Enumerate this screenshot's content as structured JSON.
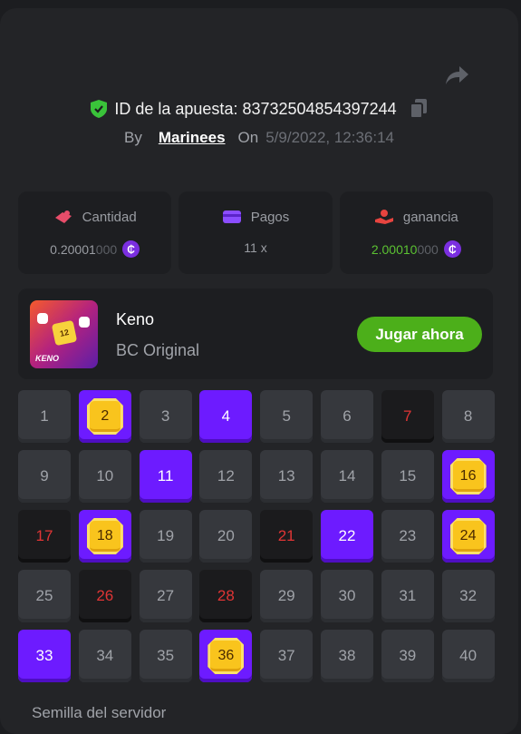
{
  "header": {
    "bet_id_label": "ID de la apuesta: 83732504854397244",
    "by_label": "By",
    "user": "Marinees",
    "on_label": "On",
    "date": "5/9/2022, 12:36:14"
  },
  "stats": [
    {
      "icon": "amount-icon",
      "label": "Cantidad",
      "value_main": "0.20001",
      "value_dim": "000",
      "color": "#e84d6a"
    },
    {
      "icon": "card-icon",
      "label": "Pagos",
      "value_main": "11 x",
      "value_dim": "",
      "color": "#8b4dff"
    },
    {
      "icon": "profit-icon",
      "label": "ganancia",
      "value_main": "2.00010",
      "value_dim": "000",
      "color": "#e8443f"
    }
  ],
  "coin_symbol": "₵",
  "game": {
    "name": "Keno",
    "subtitle": "BC Original",
    "play_label": "Jugar ahora",
    "thumb_label": "KENO",
    "thumb_tile": "12"
  },
  "grid": [
    {
      "n": "1",
      "s": "normal"
    },
    {
      "n": "2",
      "s": "gem"
    },
    {
      "n": "3",
      "s": "normal"
    },
    {
      "n": "4",
      "s": "pick"
    },
    {
      "n": "5",
      "s": "normal"
    },
    {
      "n": "6",
      "s": "normal"
    },
    {
      "n": "7",
      "s": "miss"
    },
    {
      "n": "8",
      "s": "normal"
    },
    {
      "n": "9",
      "s": "normal"
    },
    {
      "n": "10",
      "s": "normal"
    },
    {
      "n": "11",
      "s": "pick"
    },
    {
      "n": "12",
      "s": "normal"
    },
    {
      "n": "13",
      "s": "normal"
    },
    {
      "n": "14",
      "s": "normal"
    },
    {
      "n": "15",
      "s": "normal"
    },
    {
      "n": "16",
      "s": "gem"
    },
    {
      "n": "17",
      "s": "miss"
    },
    {
      "n": "18",
      "s": "gem"
    },
    {
      "n": "19",
      "s": "normal"
    },
    {
      "n": "20",
      "s": "normal"
    },
    {
      "n": "21",
      "s": "miss"
    },
    {
      "n": "22",
      "s": "pick"
    },
    {
      "n": "23",
      "s": "normal"
    },
    {
      "n": "24",
      "s": "gem"
    },
    {
      "n": "25",
      "s": "normal"
    },
    {
      "n": "26",
      "s": "miss"
    },
    {
      "n": "27",
      "s": "normal"
    },
    {
      "n": "28",
      "s": "miss"
    },
    {
      "n": "29",
      "s": "normal"
    },
    {
      "n": "30",
      "s": "normal"
    },
    {
      "n": "31",
      "s": "normal"
    },
    {
      "n": "32",
      "s": "normal"
    },
    {
      "n": "33",
      "s": "pick"
    },
    {
      "n": "34",
      "s": "normal"
    },
    {
      "n": "35",
      "s": "normal"
    },
    {
      "n": "36",
      "s": "gem"
    },
    {
      "n": "37",
      "s": "normal"
    },
    {
      "n": "38",
      "s": "normal"
    },
    {
      "n": "39",
      "s": "normal"
    },
    {
      "n": "40",
      "s": "normal"
    }
  ],
  "seed_label": "Semilla del servidor",
  "colors": {
    "accent": "#6d1bff",
    "win": "#5bc232",
    "miss": "#e03535",
    "gem": "#f9c41d"
  }
}
